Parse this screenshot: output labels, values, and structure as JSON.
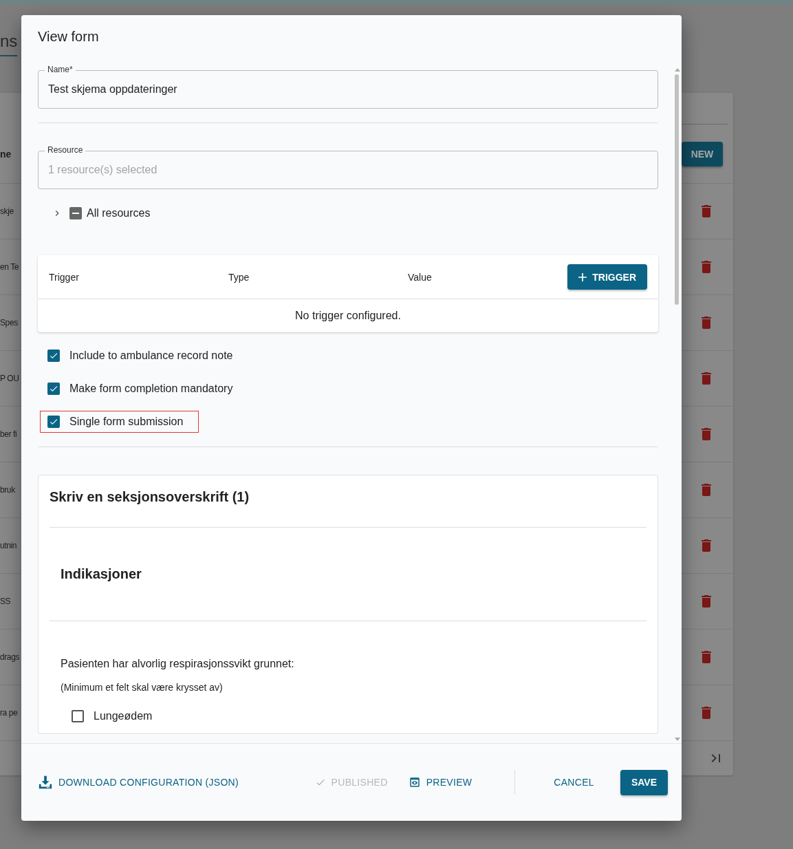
{
  "background": {
    "tab_label": "ns",
    "column_heading": "ne",
    "new_button": "NEW",
    "rows": [
      "skje",
      "en Te",
      "Spes",
      "P OU",
      "ber fi",
      "bruk",
      "utnin",
      "SS",
      "drags",
      "ra pe"
    ]
  },
  "dialog": {
    "title": "View form",
    "name_field": {
      "label": "Name*",
      "value": "Test skjema oppdateringer"
    },
    "resource_field": {
      "label": "Resource",
      "placeholder": "1 resource(s) selected"
    },
    "resource_tree": {
      "label": "All resources",
      "expanded": false,
      "indeterminate": true
    },
    "trigger_table": {
      "columns": [
        "Trigger",
        "Type",
        "Value"
      ],
      "add_button": "TRIGGER",
      "empty_text": "No trigger configured."
    },
    "options": [
      {
        "label": "Include to ambulance record note",
        "checked": true,
        "highlighted": false
      },
      {
        "label": "Make form completion mandatory",
        "checked": true,
        "highlighted": false
      },
      {
        "label": "Single form submission",
        "checked": true,
        "highlighted": true
      }
    ],
    "section": {
      "title": "Skriv en seksjonsoverskrift (1)",
      "subtitle": "Indikasjoner",
      "question": "Pasienten har alvorlig respirasjonssvikt grunnet:",
      "hint": "(Minimum et felt skal være krysset av)",
      "choices": [
        {
          "label": "Lungeødem",
          "checked": false
        }
      ]
    },
    "footer": {
      "download": "DOWNLOAD CONFIGURATION (JSON)",
      "published": {
        "label": "PUBLISHED",
        "disabled": true
      },
      "preview": "PREVIEW",
      "cancel": "CANCEL",
      "save": "SAVE"
    }
  }
}
